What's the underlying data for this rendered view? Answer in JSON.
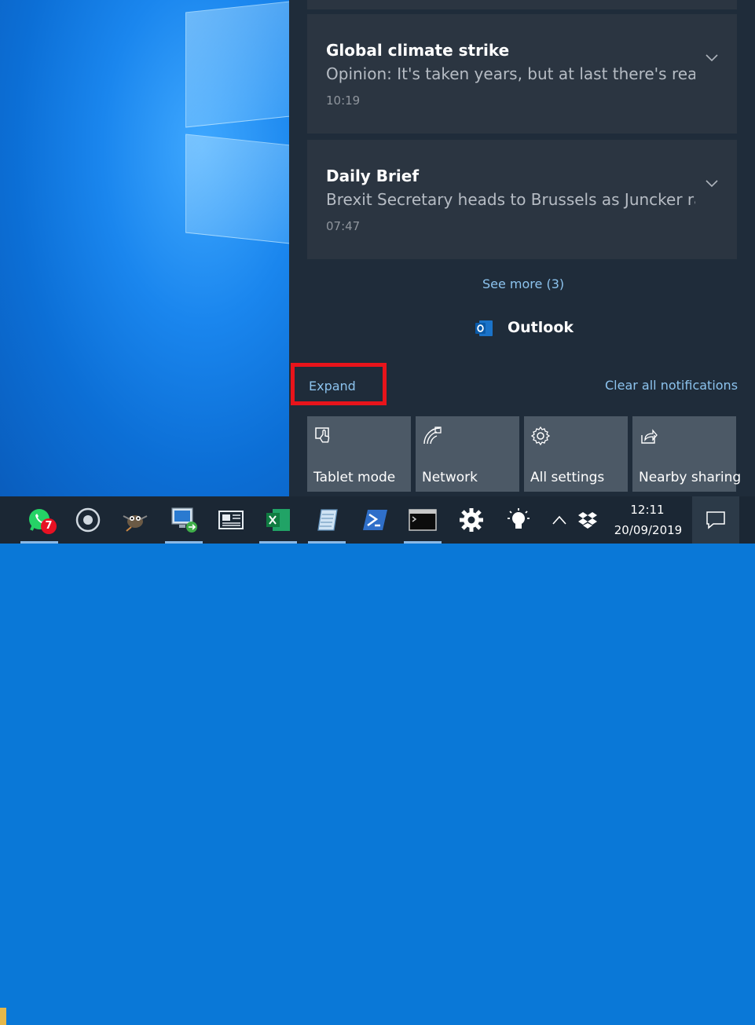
{
  "notifications": [
    {
      "title": "Global climate strike",
      "body": "Opinion: It's taken years, but at last there's real",
      "time": "10:19"
    },
    {
      "title": "Daily Brief",
      "body": "Brexit Secretary heads to Brussels as Juncker ra",
      "time": "07:47"
    }
  ],
  "see_more": "See more (3)",
  "app_group": {
    "name": "Outlook",
    "icon": "outlook-icon"
  },
  "expand_label": "Expand",
  "clear_all_label": "Clear all notifications",
  "quick_actions": [
    {
      "label": "Tablet mode",
      "icon": "tablet-mode-icon"
    },
    {
      "label": "Network",
      "icon": "network-icon"
    },
    {
      "label": "All settings",
      "icon": "settings-gear-icon"
    },
    {
      "label": "Nearby sharing",
      "icon": "nearby-sharing-icon"
    }
  ],
  "taskbar": {
    "whatsapp_badge": "7",
    "clock_time": "12:11",
    "clock_date": "20/09/2019",
    "apps": [
      "whatsapp-icon",
      "cortana-icon",
      "gimp-icon",
      "remote-desktop-icon",
      "news-icon",
      "excel-icon",
      "notepad-icon",
      "powershell-icon",
      "command-prompt-icon",
      "settings-icon",
      "tips-bulb-icon"
    ]
  },
  "colors": {
    "action_center_bg": "#1f2c3a",
    "card_bg": "#2b3541",
    "tile_bg": "#4c5966",
    "link": "#8cc3ee",
    "highlight": "#e8141b",
    "taskbar_bg": "#1b2734"
  }
}
